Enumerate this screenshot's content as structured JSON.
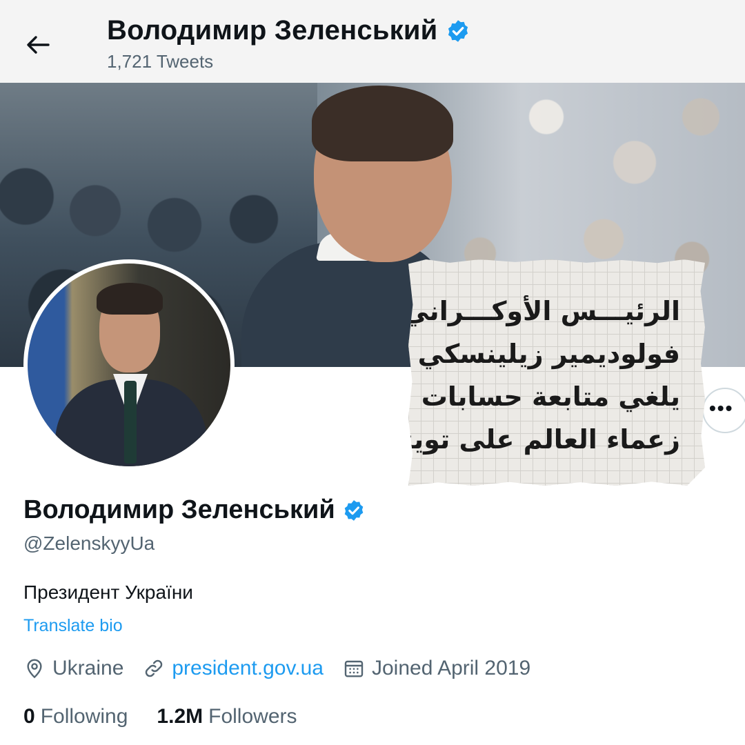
{
  "header": {
    "name": "Володимир Зеленський",
    "tweet_count": "1,721 Tweets",
    "back_icon": "arrow-left-icon",
    "verified_icon": "verified-badge-icon"
  },
  "overlay": {
    "lines": [
      "الرئيـــس الأوكـــراني",
      "فولوديمير زيلينسكي",
      "يلغي متابعة حسابات",
      "زعماء العالم على تويتر"
    ]
  },
  "profile": {
    "display_name": "Володимир Зеленський",
    "handle": "@ZelenskyyUa",
    "bio": "Президент України",
    "translate_label": "Translate bio",
    "location": "Ukraine",
    "website": "president.gov.ua",
    "joined": "Joined April 2019",
    "following_count": "0",
    "following_label": "Following",
    "followers_count": "1.2M",
    "followers_label": "Followers",
    "more_icon": "more-horizontal-icon"
  },
  "colors": {
    "accent": "#1d9bf0",
    "secondary_text": "#536471",
    "primary_text": "#0f1419"
  }
}
